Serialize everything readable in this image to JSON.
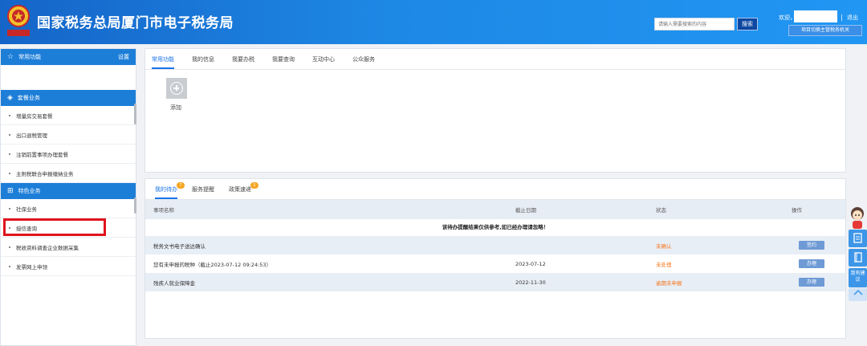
{
  "header": {
    "site_title": "国家税务总局厦门市电子税务局",
    "search_placeholder": "请输入需要搜索的内容",
    "search_button": "搜索",
    "welcome": "欢迎，",
    "separator": "|",
    "logout": "退出",
    "switch_button": "项目切换主管税务机关"
  },
  "sidebar": {
    "common_title": "常用功能",
    "common_settings": "设置",
    "package_title": "套餐业务",
    "package_items": [
      "增量房交易套餐",
      "出口退税管理",
      "注销前置事项办理套餐",
      "主附税联合申报缴纳业务"
    ],
    "special_title": "特色业务",
    "special_items": [
      "社保业务",
      "授信查询",
      "税收资料调查企业数据采集",
      "发票网上申领"
    ]
  },
  "top_panel": {
    "tabs": [
      "常用功能",
      "我的信息",
      "我要办税",
      "我要查询",
      "互动中心",
      "公众服务"
    ],
    "active_tab": "常用功能",
    "add_label": "添加"
  },
  "bottom_panel": {
    "tabs": [
      {
        "label": "我的待办",
        "badge": "7"
      },
      {
        "label": "服务提醒",
        "badge": ""
      },
      {
        "label": "政策速递",
        "badge": "1"
      }
    ],
    "columns": [
      "事项名称",
      "截止日期",
      "状态",
      "操作"
    ],
    "notice": "该待办提醒结果仅供参考,如已经办理请忽略！",
    "rows": [
      {
        "name": "税务文书电子送达确认",
        "date": "",
        "status": "未确认",
        "action": "签约"
      },
      {
        "name": "您有未申报的税种（截止2023-07-12 09:24:53）",
        "date": "2023-07-12",
        "status": "未处理",
        "action": "办理"
      },
      {
        "name": "残疾人就业保障金",
        "date": "2022-11-30",
        "status": "逾期未申报",
        "action": "办理"
      }
    ]
  },
  "floats": {
    "suggest": "我有建议"
  },
  "colors": {
    "header_blue": "#1e88e5",
    "accent": "#1a73e8",
    "status_orange": "#f5761a",
    "highlight_red": "#e0141e"
  }
}
